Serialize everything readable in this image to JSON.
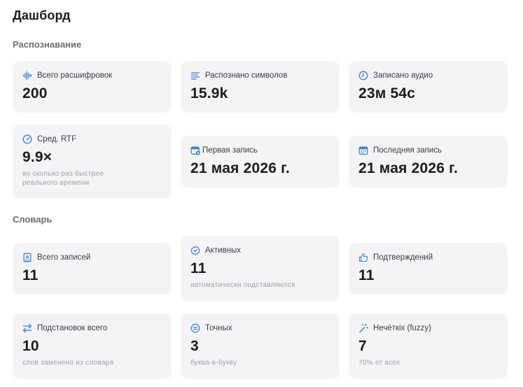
{
  "page": {
    "title": "Дашборд"
  },
  "colors": {
    "accent": "#3a7fd8",
    "card_bg": "#f4f4f6"
  },
  "recognition": {
    "title": "Распознавание",
    "cards": [
      {
        "icon": "waveform-icon",
        "label": "Всего расшифровок",
        "value": "200"
      },
      {
        "icon": "text-lines-icon",
        "label": "Распознано символов",
        "value": "15.9k"
      },
      {
        "icon": "clock-icon",
        "label": "Записано аудио",
        "value": "23м 54с"
      },
      {
        "icon": "gauge-icon",
        "label": "Сред. RTF",
        "value": "9.9×",
        "sub": "во сколько раз быстрее реального времени"
      },
      {
        "icon": "calendar-plus-icon",
        "label": "Первая запись",
        "value": "21 мая 2026 г."
      },
      {
        "icon": "calendar-icon",
        "label": "Последняя запись",
        "value": "21 мая 2026 г."
      }
    ]
  },
  "dictionary": {
    "title": "Словарь",
    "cards": [
      {
        "icon": "book-icon",
        "label": "Всего записей",
        "value": "11"
      },
      {
        "icon": "checkmark-seal-icon",
        "label": "Активных",
        "value": "11",
        "sub": "автоматически подставляются"
      },
      {
        "icon": "thumbs-up-icon",
        "label": "Подтверждений",
        "value": "11"
      },
      {
        "icon": "arrows-swap-icon",
        "label": "Подстановок всего",
        "value": "10",
        "sub": "слов заменено из словаря"
      },
      {
        "icon": "equal-circle-icon",
        "label": "Точных",
        "value": "3",
        "sub": "буква-в-букву"
      },
      {
        "icon": "magic-wand-icon",
        "label": "Нечёткіх (fuzzy)",
        "value": "7",
        "sub": "70% от всех"
      }
    ]
  }
}
